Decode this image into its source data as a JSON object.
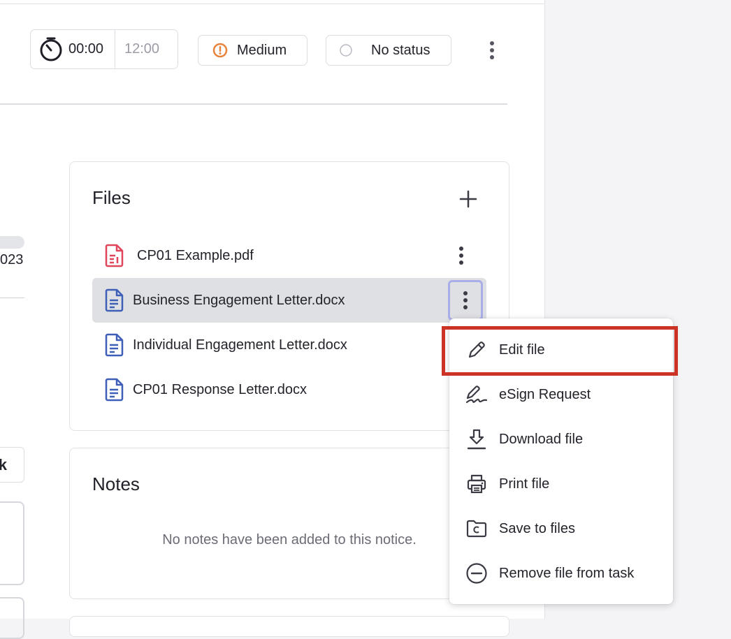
{
  "header": {
    "timer": {
      "elapsed": "00:00",
      "estimate": "12:00"
    },
    "priority": {
      "label": "Medium",
      "color": "#e8843a"
    },
    "status": {
      "label": "No status"
    }
  },
  "left_fragment": {
    "date_tail": "023",
    "button_tail": "k"
  },
  "files": {
    "title": "Files",
    "items": [
      {
        "name": "CP01 Example.pdf",
        "type": "pdf",
        "icon": "pdf-file-icon",
        "selected": false
      },
      {
        "name": "Business Engagement Letter.docx",
        "type": "docx",
        "icon": "doc-file-icon",
        "selected": true
      },
      {
        "name": "Individual Engagement Letter.docx",
        "type": "docx",
        "icon": "doc-file-icon",
        "selected": false
      },
      {
        "name": "CP01 Response Letter.docx",
        "type": "docx",
        "icon": "doc-file-icon",
        "selected": false
      }
    ]
  },
  "notes": {
    "title": "Notes",
    "empty_text": "No notes have been added to this notice."
  },
  "context_menu": {
    "items": [
      {
        "label": "Edit file",
        "icon": "pencil-icon",
        "highlighted": true
      },
      {
        "label": "eSign Request",
        "icon": "signature-icon"
      },
      {
        "label": "Download file",
        "icon": "download-icon"
      },
      {
        "label": "Print file",
        "icon": "printer-icon"
      },
      {
        "label": "Save to files",
        "icon": "folder-icon"
      },
      {
        "label": "Remove file from task",
        "icon": "minus-circle-icon"
      }
    ]
  },
  "colors": {
    "pdf_icon": "#e0455b",
    "doc_icon": "#3e5fb8",
    "highlight": "#cc3325",
    "selected_row": "#dfe0e4",
    "focus_ring": "#a9aee8"
  }
}
